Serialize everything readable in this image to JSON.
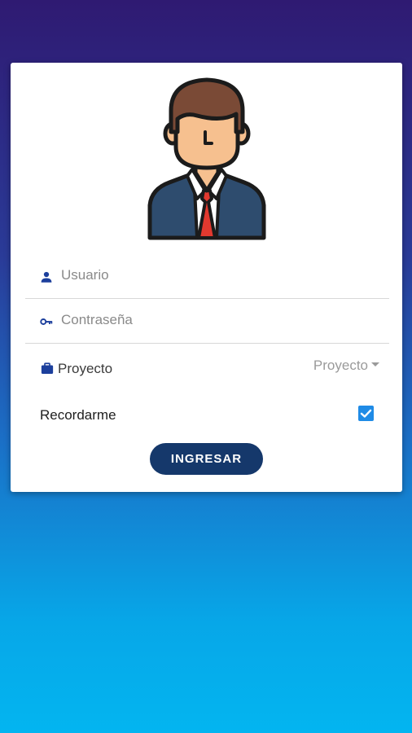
{
  "form": {
    "username_placeholder": "Usuario",
    "password_placeholder": "Contraseña",
    "project_label": "Proyecto",
    "project_selected": "Proyecto",
    "remember_label": "Recordarme",
    "remember_checked": true,
    "submit_label": "INGRESAR"
  },
  "colors": {
    "button_bg": "#15386b",
    "icon_color": "#1c3f9c",
    "checkbox_color": "#1f8be6",
    "gradient_top": "#2f1a72",
    "gradient_bottom": "#03b5f0"
  },
  "icons": {
    "avatar": "businessman-avatar-icon",
    "username": "person-icon",
    "password": "key-icon",
    "project": "briefcase-icon",
    "remember": "checkbox-checked-icon"
  }
}
